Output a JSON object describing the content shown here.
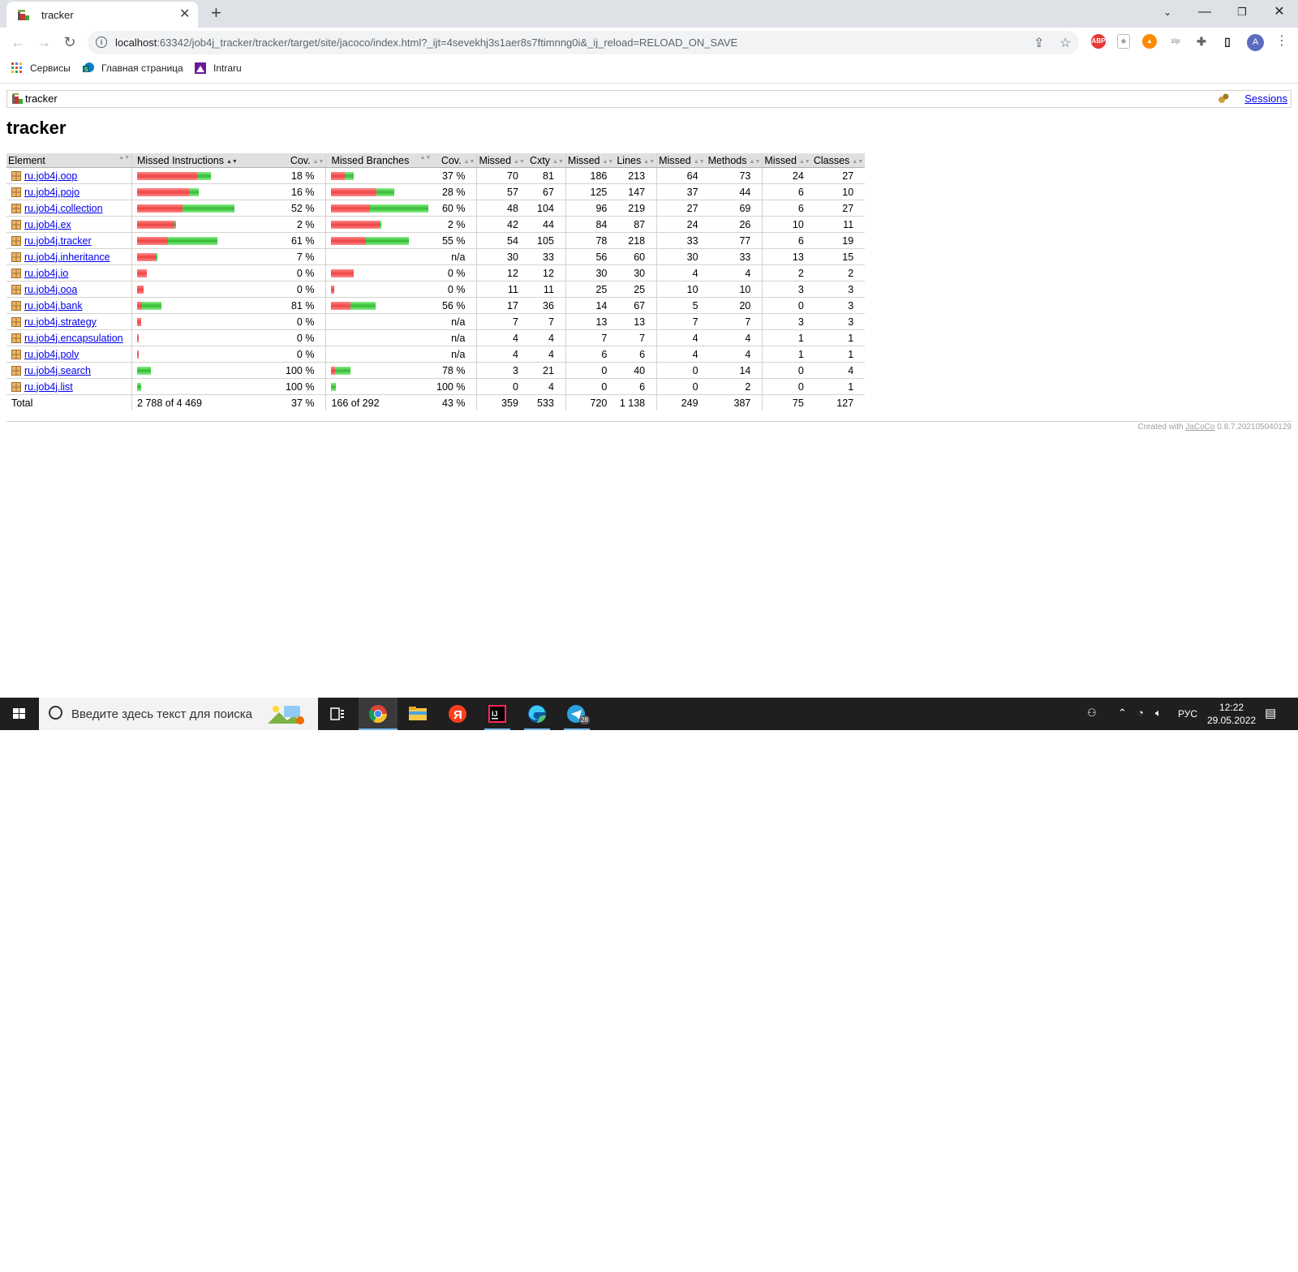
{
  "browser": {
    "tab_title": "tracker",
    "url_host": "localhost",
    "url_rest": ":63342/job4j_tracker/tracker/target/site/jacoco/index.html?_ijt=4sevekhj3s1aer8s7ftimnng0i&_ij_reload=RELOAD_ON_SAVE",
    "avatar_letter": "A",
    "bookmarks": [
      "Сервисы",
      "Главная страница",
      "Intraru"
    ]
  },
  "report": {
    "breadcrumb": "tracker",
    "sessions_label": "Sessions",
    "title": "tracker",
    "headers": [
      "Element",
      "Missed Instructions",
      "Cov.",
      "Missed Branches",
      "Cov.",
      "Missed",
      "Cxty",
      "Missed",
      "Lines",
      "Missed",
      "Methods",
      "Missed",
      "Classes"
    ],
    "rows": [
      {
        "name": "ru.job4j.oop",
        "instr_cov": "18 %",
        "br_cov": "37 %",
        "cxty_missed": "70",
        "cxty": "81",
        "lines_missed": "186",
        "lines": "213",
        "methods_missed": "64",
        "methods": "73",
        "classes_missed": "24",
        "classes": "27",
        "instr_missed_frac": 0.16,
        "instr_covered_frac": 0.036,
        "br_missed_frac": 0.096,
        "br_covered_frac": 0.055,
        "instr_bar": [
          0.62,
          0.14
        ],
        "br_bar": [
          0.14,
          0.09
        ]
      },
      {
        "name": "ru.job4j.pojo",
        "instr_cov": "16 %",
        "br_cov": "28 %",
        "cxty_missed": "57",
        "cxty": "67",
        "lines_missed": "125",
        "lines": "147",
        "methods_missed": "37",
        "methods": "44",
        "classes_missed": "6",
        "classes": "10",
        "instr_bar": [
          0.53,
          0.1
        ],
        "br_bar": [
          0.47,
          0.18
        ]
      },
      {
        "name": "ru.job4j.collection",
        "instr_cov": "52 %",
        "br_cov": "60 %",
        "cxty_missed": "48",
        "cxty": "104",
        "lines_missed": "96",
        "lines": "219",
        "methods_missed": "27",
        "methods": "69",
        "classes_missed": "6",
        "classes": "27",
        "instr_bar": [
          0.47,
          0.53
        ],
        "br_bar": [
          0.4,
          0.6
        ]
      },
      {
        "name": "ru.job4j.ex",
        "instr_cov": "2 %",
        "br_cov": "2 %",
        "cxty_missed": "42",
        "cxty": "44",
        "lines_missed": "84",
        "lines": "87",
        "methods_missed": "24",
        "methods": "26",
        "classes_missed": "10",
        "classes": "11",
        "instr_bar": [
          0.38,
          0.01
        ],
        "br_bar": [
          0.5,
          0.01
        ]
      },
      {
        "name": "ru.job4j.tracker",
        "instr_cov": "61 %",
        "br_cov": "55 %",
        "cxty_missed": "54",
        "cxty": "105",
        "lines_missed": "78",
        "lines": "218",
        "methods_missed": "33",
        "methods": "77",
        "classes_missed": "6",
        "classes": "19",
        "instr_bar": [
          0.32,
          0.51
        ],
        "br_bar": [
          0.36,
          0.44
        ]
      },
      {
        "name": "ru.job4j.inheritance",
        "instr_cov": "7 %",
        "br_cov": "n/a",
        "cxty_missed": "30",
        "cxty": "33",
        "lines_missed": "56",
        "lines": "60",
        "methods_missed": "30",
        "methods": "33",
        "classes_missed": "13",
        "classes": "15",
        "instr_bar": [
          0.19,
          0.01
        ],
        "br_bar": [
          0,
          0
        ]
      },
      {
        "name": "ru.job4j.io",
        "instr_cov": "0 %",
        "br_cov": "0 %",
        "cxty_missed": "12",
        "cxty": "12",
        "lines_missed": "30",
        "lines": "30",
        "methods_missed": "4",
        "methods": "4",
        "classes_missed": "2",
        "classes": "2",
        "instr_bar": [
          0.1,
          0
        ],
        "br_bar": [
          0.23,
          0
        ]
      },
      {
        "name": "ru.job4j.ooa",
        "instr_cov": "0 %",
        "br_cov": "0 %",
        "cxty_missed": "11",
        "cxty": "11",
        "lines_missed": "25",
        "lines": "25",
        "methods_missed": "10",
        "methods": "10",
        "classes_missed": "3",
        "classes": "3",
        "instr_bar": [
          0.07,
          0
        ],
        "br_bar": [
          0.03,
          0
        ]
      },
      {
        "name": "ru.job4j.bank",
        "instr_cov": "81 %",
        "br_cov": "56 %",
        "cxty_missed": "17",
        "cxty": "36",
        "lines_missed": "14",
        "lines": "67",
        "methods_missed": "5",
        "methods": "20",
        "classes_missed": "0",
        "classes": "3",
        "instr_bar": [
          0.05,
          0.2
        ],
        "br_bar": [
          0.2,
          0.26
        ]
      },
      {
        "name": "ru.job4j.strategy",
        "instr_cov": "0 %",
        "br_cov": "n/a",
        "cxty_missed": "7",
        "cxty": "7",
        "lines_missed": "13",
        "lines": "13",
        "methods_missed": "7",
        "methods": "7",
        "classes_missed": "3",
        "classes": "3",
        "instr_bar": [
          0.04,
          0
        ],
        "br_bar": [
          0,
          0
        ]
      },
      {
        "name": "ru.job4j.encapsulation",
        "instr_cov": "0 %",
        "br_cov": "n/a",
        "cxty_missed": "4",
        "cxty": "4",
        "lines_missed": "7",
        "lines": "7",
        "methods_missed": "4",
        "methods": "4",
        "classes_missed": "1",
        "classes": "1",
        "instr_bar": [
          0.02,
          0
        ],
        "br_bar": [
          0,
          0
        ]
      },
      {
        "name": "ru.job4j.poly",
        "instr_cov": "0 %",
        "br_cov": "n/a",
        "cxty_missed": "4",
        "cxty": "4",
        "lines_missed": "6",
        "lines": "6",
        "methods_missed": "4",
        "methods": "4",
        "classes_missed": "1",
        "classes": "1",
        "instr_bar": [
          0.01,
          0
        ],
        "br_bar": [
          0,
          0
        ]
      },
      {
        "name": "ru.job4j.search",
        "instr_cov": "100 %",
        "br_cov": "78 %",
        "cxty_missed": "3",
        "cxty": "21",
        "lines_missed": "0",
        "lines": "40",
        "methods_missed": "0",
        "methods": "14",
        "classes_missed": "0",
        "classes": "4",
        "instr_bar": [
          0,
          0.14
        ],
        "br_bar": [
          0.04,
          0.16
        ]
      },
      {
        "name": "ru.job4j.list",
        "instr_cov": "100 %",
        "br_cov": "100 %",
        "cxty_missed": "0",
        "cxty": "4",
        "lines_missed": "0",
        "lines": "6",
        "methods_missed": "0",
        "methods": "2",
        "classes_missed": "0",
        "classes": "1",
        "instr_bar": [
          0,
          0.04
        ],
        "br_bar": [
          0,
          0.05
        ]
      }
    ],
    "total": {
      "label": "Total",
      "instr": "2 788 of 4 469",
      "instr_cov": "37 %",
      "br": "166 of 292",
      "br_cov": "43 %",
      "cxty_missed": "359",
      "cxty": "533",
      "lines_missed": "720",
      "lines": "1 138",
      "methods_missed": "249",
      "methods": "387",
      "classes_missed": "75",
      "classes": "127"
    },
    "footer_prefix": "Created with ",
    "footer_link": "JaCoCo",
    "footer_version": " 0.8.7.202105040129"
  },
  "taskbar": {
    "search_placeholder": "Введите здесь текст для поиска",
    "lang": "РУС",
    "time": "12:22",
    "date": "29.05.2022",
    "telegram_badge": "28"
  },
  "colors": {
    "missed": "#e44444",
    "covered": "#33bb33",
    "link": "#0000ee",
    "header_bg": "#e0e0e0",
    "taskbar": "#1f1f1f"
  }
}
